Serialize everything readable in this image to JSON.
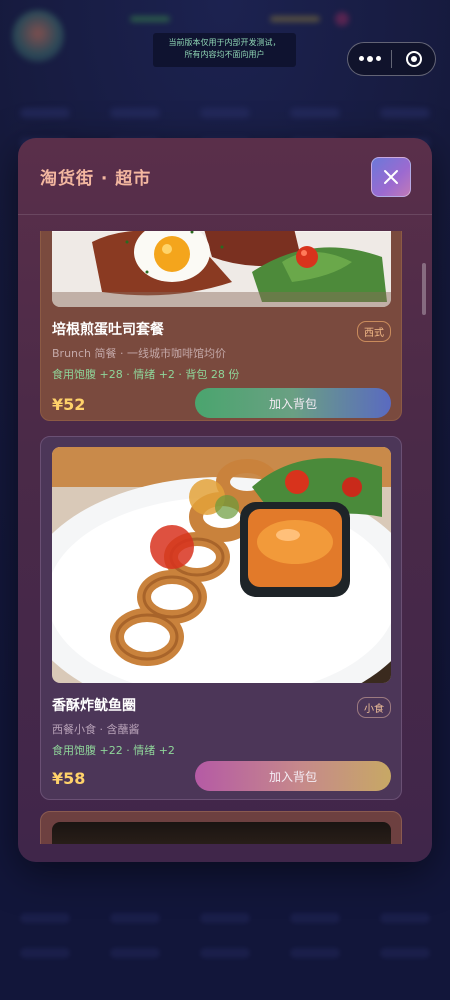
{
  "system": {
    "dev_notice_line1": "当前版本仅用于内部开发测试，",
    "dev_notice_line2": "所有内容均不面向用户"
  },
  "modal": {
    "title": "淘货街 · 超市",
    "close_icon": "close-icon"
  },
  "items": [
    {
      "name": "培根煎蛋吐司套餐",
      "tag": "西式",
      "desc": "Brunch 简餐 · 一线城市咖啡馆均价",
      "stats": "食用饱腹 +28 · 情绪 +2 · 背包 28 份",
      "price": "¥52",
      "button": "加入背包"
    },
    {
      "name": "香酥炸鱿鱼圈",
      "tag": "小食",
      "desc": "西餐小食 · 含蘸酱",
      "stats": "食用饱腹 +22 · 情绪 +2",
      "price": "¥58",
      "button": "加入背包"
    }
  ],
  "colors": {
    "title": "#f3b7a0",
    "price": "#ffd26a",
    "stats": "#8fd69a"
  }
}
